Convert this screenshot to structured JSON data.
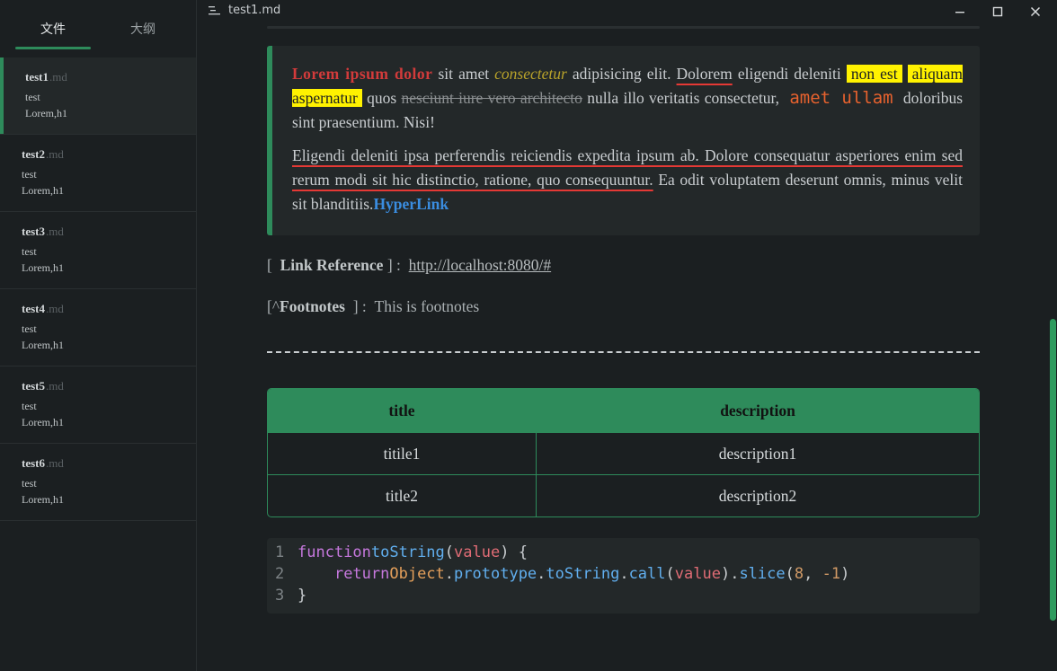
{
  "sidebar": {
    "tabs": [
      {
        "label": "文件",
        "active": true
      },
      {
        "label": "大纲",
        "active": false
      }
    ],
    "files": [
      {
        "name": "test1",
        "ext": ".md",
        "line1": "test",
        "line2": "Lorem,h1",
        "active": true
      },
      {
        "name": "test2",
        "ext": ".md",
        "line1": "test",
        "line2": "Lorem,h1"
      },
      {
        "name": "test3",
        "ext": ".md",
        "line1": "test",
        "line2": "Lorem,h1"
      },
      {
        "name": "test4",
        "ext": ".md",
        "line1": "test",
        "line2": "Lorem,h1"
      },
      {
        "name": "test5",
        "ext": ".md",
        "line1": "test",
        "line2": "Lorem,h1"
      },
      {
        "name": "test6",
        "ext": ".md",
        "line1": "test",
        "line2": "Lorem,h1"
      }
    ]
  },
  "titlebar": {
    "title": "test1.md",
    "icons": {
      "doc": "document-lines-icon",
      "minimize": "minimize-icon",
      "maximize": "maximize-icon",
      "close": "close-icon"
    }
  },
  "blockquote": {
    "p1": {
      "bold_red": "Lorem ipsum dolor",
      "t1": " sit amet ",
      "italic": "consectetur",
      "t2": " adipisicing elit. ",
      "underlined": "Dolorem",
      "t3": " eligendi deleniti ",
      "highlight1": "non est",
      "highlight2": "aliquam aspernatur",
      "t4": " quos ",
      "strike": "nesciunt iure vero architecto",
      "t5": " nulla illo veritatis consectetur, ",
      "code": "amet ullam",
      "t6": " doloribus sint praesentium. Nisi!"
    },
    "p2": {
      "underlined": "Eligendi deleniti ipsa perferendis reiciendis expedita ipsum ab. Dolore consequatur asperiores enim sed rerum modi sit hic distinctio, ratione, quo consequuntur.",
      "t1": " Ea odit voluptatem deserunt omnis, minus velit sit blanditiis.",
      "link": "HyperLink"
    }
  },
  "reference": {
    "open": "[",
    "label": "Link Reference",
    "close": "] :",
    "url": "http://localhost:8080/#"
  },
  "footnote": {
    "open": "[^",
    "label": "Footnotes",
    "close": "] :",
    "text": "This is footnotes"
  },
  "table": {
    "headers": [
      "title",
      "description"
    ],
    "rows": [
      [
        "titile1",
        "description1"
      ],
      [
        "title2",
        "description2"
      ]
    ]
  },
  "code": {
    "line_numbers": [
      "1",
      "2",
      "3"
    ],
    "tokens": {
      "function": "function",
      "fname": "toString",
      "open1": "(",
      "param": "value",
      "close1": ") {",
      "indent": "    ",
      "return": "return",
      "object": "Object",
      "dot1": ".",
      "prototype": "prototype",
      "dot2": ".",
      "tostring": "toString",
      "dot3": ".",
      "call": "call",
      "open2": "(",
      "param2": "value",
      "close2": ").",
      "slice": "slice",
      "open3": "(",
      "n8": "8",
      "comma": ", ",
      "nm1": "-1",
      "close3": ")",
      "brace": "}"
    }
  },
  "colors": {
    "accent": "#2e8b5b",
    "background": "#1b1f21",
    "panel": "#232829",
    "highlight": "#fff200",
    "link": "#3a8de0"
  }
}
